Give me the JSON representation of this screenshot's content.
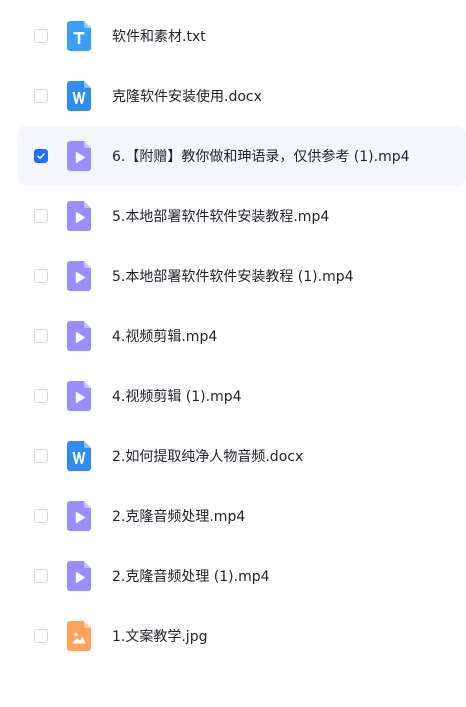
{
  "files": [
    {
      "name": "软件和素材.txt",
      "type": "txt",
      "checked": false
    },
    {
      "name": "克隆软件安装使用.docx",
      "type": "docx",
      "checked": false
    },
    {
      "name": "6.【附赠】教你做和珅语录，仅供参考 (1).mp4",
      "type": "mp4",
      "checked": true
    },
    {
      "name": "5.本地部署软件软件安装教程.mp4",
      "type": "mp4",
      "checked": false
    },
    {
      "name": "5.本地部署软件软件安装教程 (1).mp4",
      "type": "mp4",
      "checked": false
    },
    {
      "name": "4.视频剪辑.mp4",
      "type": "mp4",
      "checked": false
    },
    {
      "name": "4.视频剪辑 (1).mp4",
      "type": "mp4",
      "checked": false
    },
    {
      "name": "2.如何提取纯净人物音频.docx",
      "type": "docx",
      "checked": false
    },
    {
      "name": "2.克隆音频处理.mp4",
      "type": "mp4",
      "checked": false
    },
    {
      "name": "2.克隆音频处理 (1).mp4",
      "type": "mp4",
      "checked": false
    },
    {
      "name": "1.文案教学.jpg",
      "type": "jpg",
      "checked": false
    }
  ],
  "icon_colors": {
    "txt": "#3aa0f5",
    "docx": "#2e8df2",
    "mp4": "#9b8cff",
    "jpg": "#ffa35c"
  },
  "icons": {
    "txt": "text-file-icon",
    "docx": "word-file-icon",
    "mp4": "video-file-icon",
    "jpg": "image-file-icon"
  },
  "checkbox_accent": "#1f6fff"
}
